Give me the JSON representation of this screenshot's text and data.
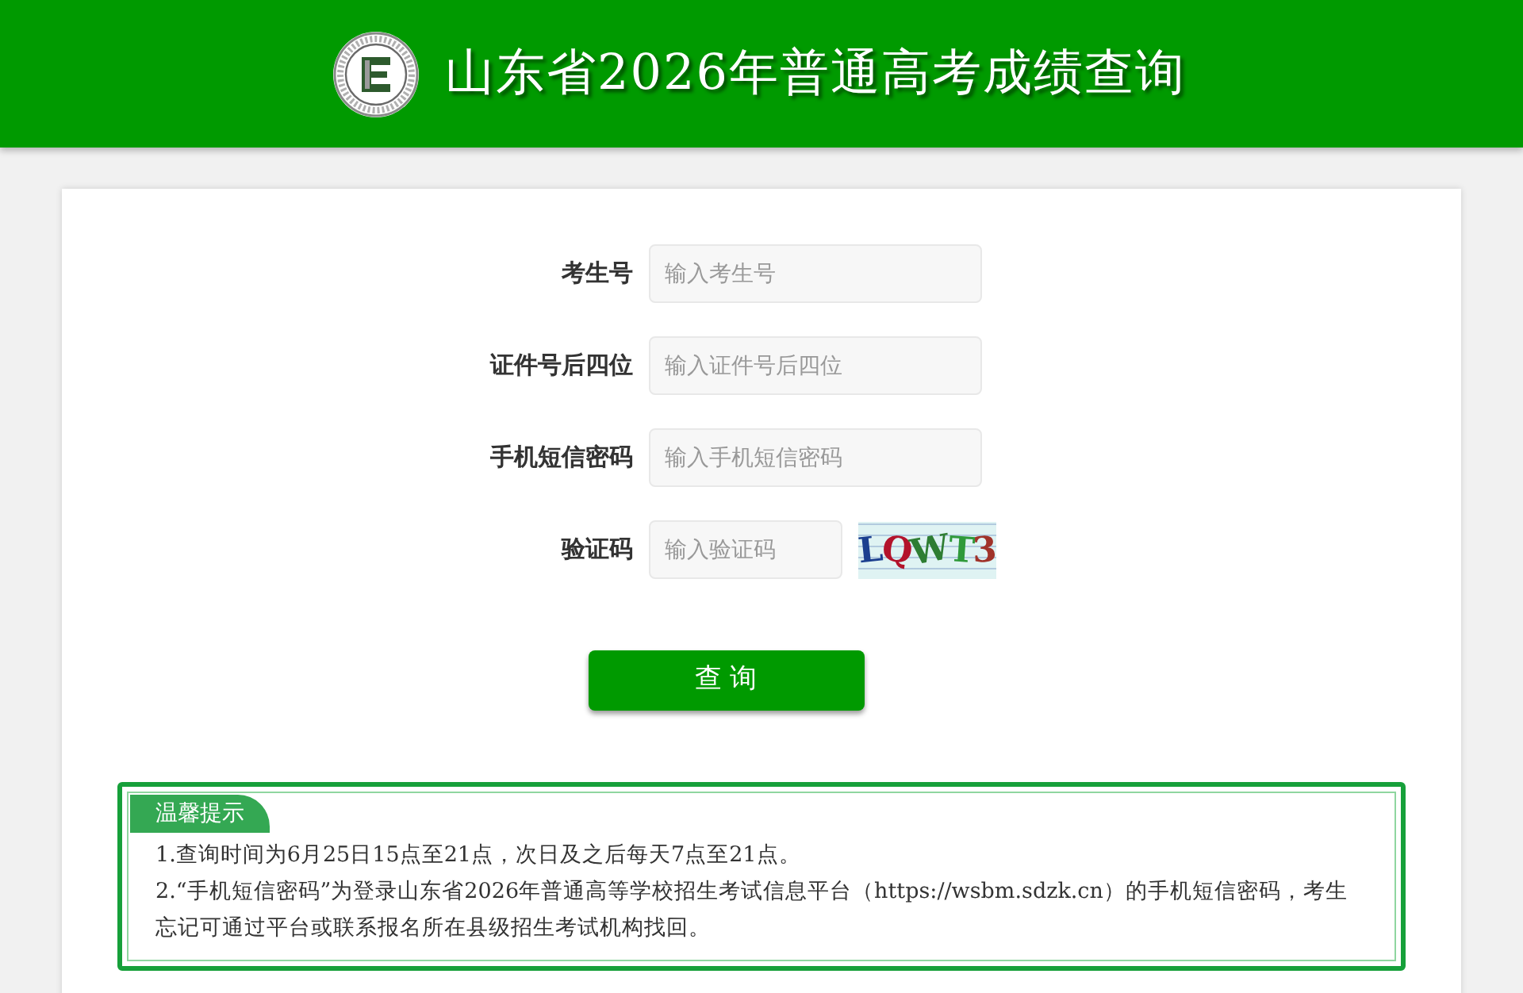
{
  "header": {
    "title": "山东省2026年普通高考成绩查询"
  },
  "form": {
    "fields": [
      {
        "kind": "text",
        "label": "考生号",
        "placeholder": "输入考生号"
      },
      {
        "kind": "text",
        "label": "证件号后四位",
        "placeholder": "输入证件号后四位"
      },
      {
        "kind": "text",
        "label": "手机短信密码",
        "placeholder": "输入手机短信密码"
      },
      {
        "kind": "captcha",
        "label": "验证码",
        "placeholder": "输入验证码",
        "captcha": "LQWT3"
      }
    ],
    "submit": "查 询"
  },
  "notice": {
    "title": "温馨提示",
    "items": [
      "1.查询时间为6月25日15点至21点，次日及之后每天7点至21点。",
      "2.“手机短信密码”为登录山东省2026年普通高等学校招生考试信息平台（https://wsbm.sdzk.cn）的手机短信密码，考生忘记可通过平台或联系报名所在县级招生考试机构找回。"
    ]
  }
}
